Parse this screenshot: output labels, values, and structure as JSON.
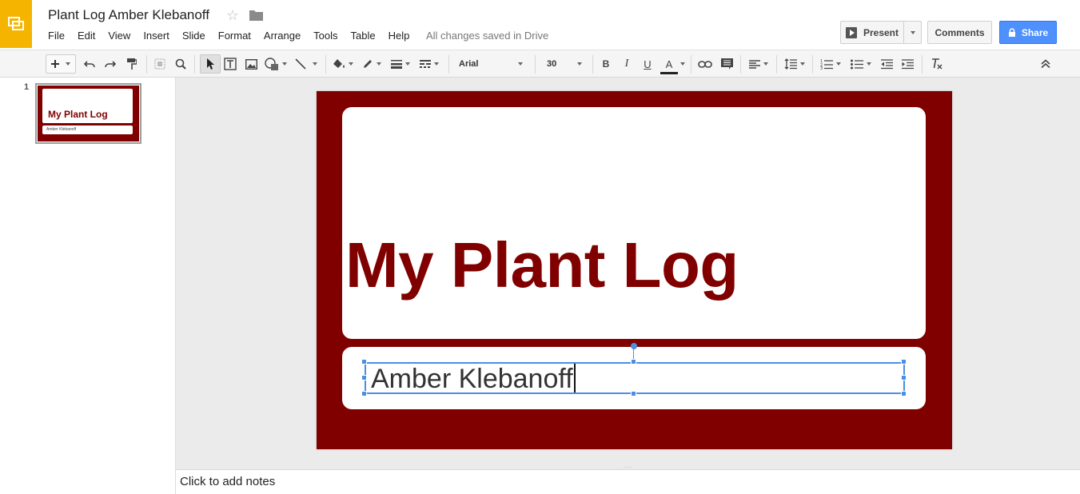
{
  "app": {
    "doc_title": "Plant Log Amber Klebanoff",
    "save_status": "All changes saved in Drive",
    "accent_color": "#f4b400",
    "share_color": "#4d90fe",
    "icons": [
      "slides-logo-icon",
      "star-icon",
      "folder-icon",
      "play-icon",
      "lock-icon"
    ]
  },
  "menu": [
    "File",
    "Edit",
    "View",
    "Insert",
    "Slide",
    "Format",
    "Arrange",
    "Tools",
    "Table",
    "Help"
  ],
  "buttons": {
    "present": "Present",
    "comments": "Comments",
    "share": "Share"
  },
  "toolbar": {
    "font_family": "Arial",
    "font_size": "30",
    "bold": "B",
    "italic": "I",
    "underline": "U",
    "text_color": "A",
    "text_color_value": "#222222"
  },
  "filmstrip": {
    "slide_number": "1",
    "thumb_title": "My Plant Log",
    "thumb_subtitle": "Amber Klebanoff"
  },
  "slide": {
    "background_color": "#800000",
    "title": "My Plant Log",
    "subtitle": "Amber Klebanoff"
  },
  "notes": {
    "placeholder": "Click to add notes"
  }
}
